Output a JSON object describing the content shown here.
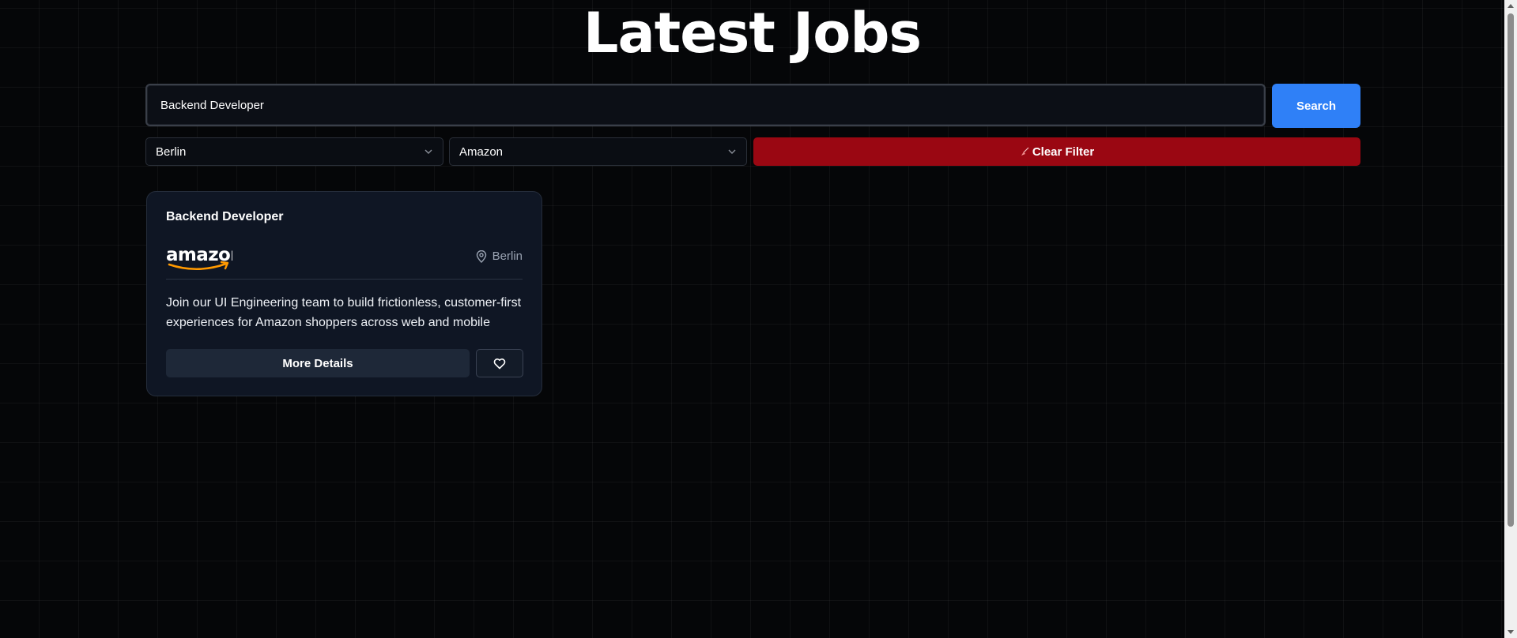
{
  "page": {
    "title": "Latest Jobs"
  },
  "search": {
    "value": "Backend Developer",
    "button_label": "Search"
  },
  "filters": {
    "location": {
      "selected": "Berlin",
      "icon": "chevron-down-icon"
    },
    "company": {
      "selected": "Amazon",
      "icon": "chevron-down-icon"
    },
    "clear_label": "Clear Filter",
    "clear_icon": "broom-icon"
  },
  "jobs": [
    {
      "title": "Backend Developer",
      "company_logo": "amazon-logo",
      "location": "Berlin",
      "description": "Join our UI Engineering team to build frictionless, customer-first experiences for Amazon shoppers across web and mobile",
      "details_label": "More Details",
      "favorite_icon": "heart-icon"
    }
  ],
  "colors": {
    "background": "#050608",
    "search_button": "#2f80f7",
    "clear_button": "#9a0712",
    "card": "#0f1624",
    "amazon_smile": "#ff9900"
  }
}
